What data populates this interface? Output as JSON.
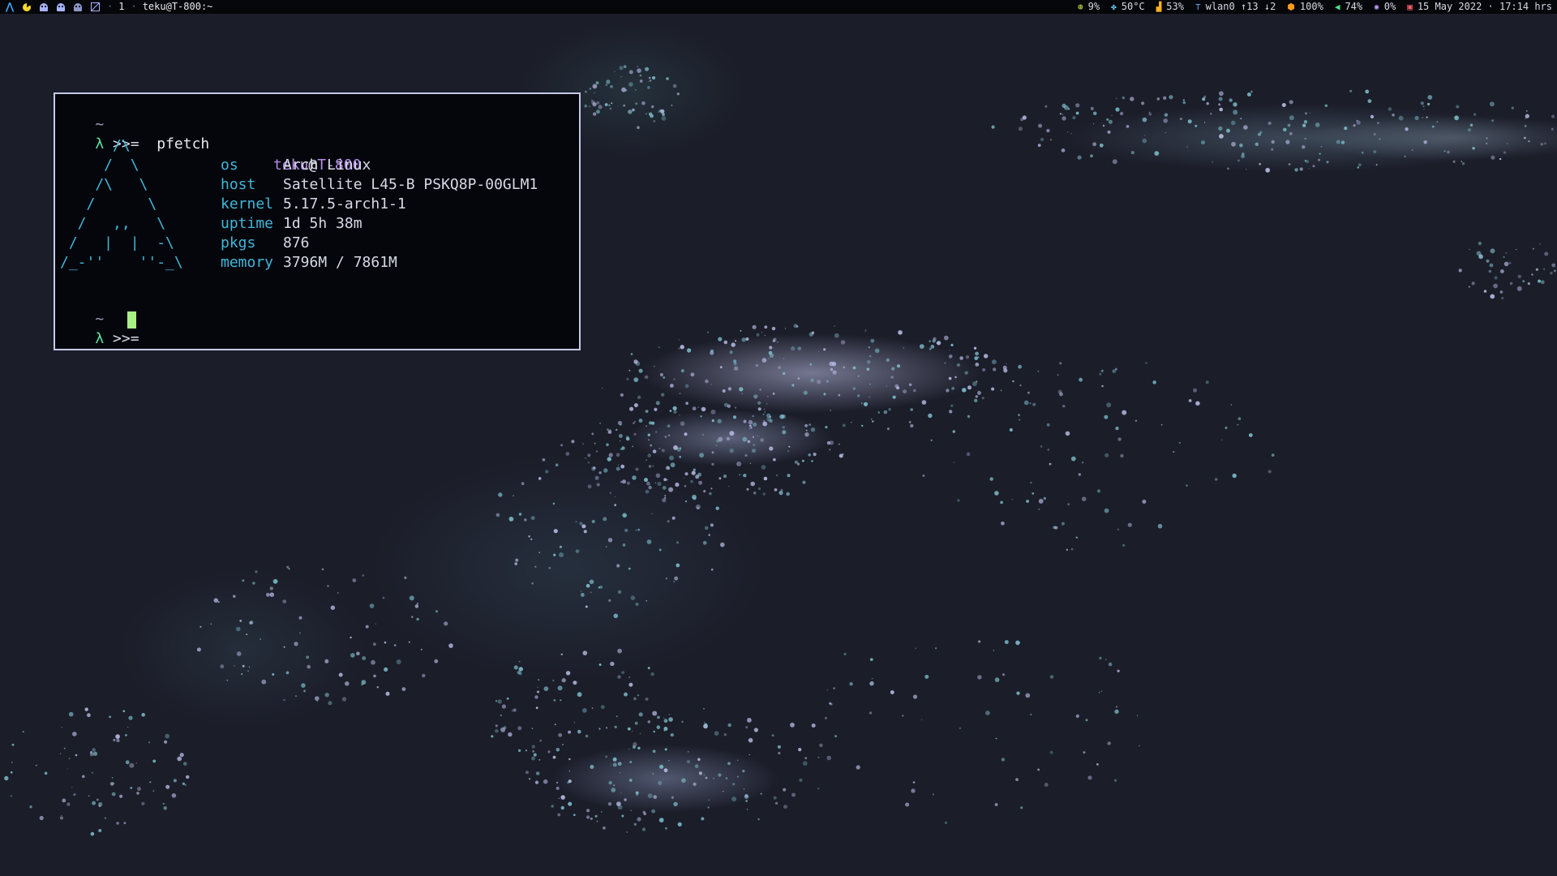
{
  "topbar": {
    "workspace_number": "1",
    "separator": "·",
    "window_title": "teku@T-800:~",
    "modules": {
      "cpu": {
        "icon": "cpu-icon",
        "value": "9%"
      },
      "temperature": {
        "icon": "fan-icon",
        "value": "50°C"
      },
      "disk": {
        "icon": "disk-icon",
        "value": "53%"
      },
      "network": {
        "icon": "network-icon",
        "value": "wlan0 ↑13 ↓2"
      },
      "battery": {
        "icon": "battery-icon",
        "value": "100%"
      },
      "volume": {
        "icon": "volume-icon",
        "value": "74%"
      },
      "brightness": {
        "icon": "brightness-icon",
        "value": "0%"
      },
      "clock": {
        "icon": "calendar-icon",
        "value": "15 May 2022 · 17:14 hrs"
      }
    }
  },
  "terminal": {
    "line1_tilde": "~",
    "prompt_symbol": "λ",
    "prompt_text": ">>=",
    "command": "pfetch",
    "ascii_art": "      /\\\n     /  \\\n    /\\   \\\n   /      \\\n  /   ,,   \\\n /   |  |  -\\\n/_-''    ''-_\\",
    "user": "teku",
    "at": "@",
    "hostname": "T-800",
    "info": [
      {
        "key": "os",
        "value": "Arch Linux"
      },
      {
        "key": "host",
        "value": "Satellite L45-B PSKQ8P-00GLM1"
      },
      {
        "key": "kernel",
        "value": "5.17.5-arch1-1"
      },
      {
        "key": "uptime",
        "value": "1d 5h 38m"
      },
      {
        "key": "pkgs",
        "value": "876"
      },
      {
        "key": "memory",
        "value": "3796M / 7861M"
      }
    ],
    "line2_tilde": "~",
    "prompt2_symbol": "λ",
    "prompt2_text": ">>="
  },
  "colors": {
    "bar_background": "#06070b",
    "terminal_background": "#05060c",
    "terminal_border": "#c5c9e6",
    "accent_cyan": "#3fb7d9",
    "accent_purple": "#b487e8",
    "prompt_green": "#5fe3a0",
    "cursor_green": "#a8ef86"
  }
}
